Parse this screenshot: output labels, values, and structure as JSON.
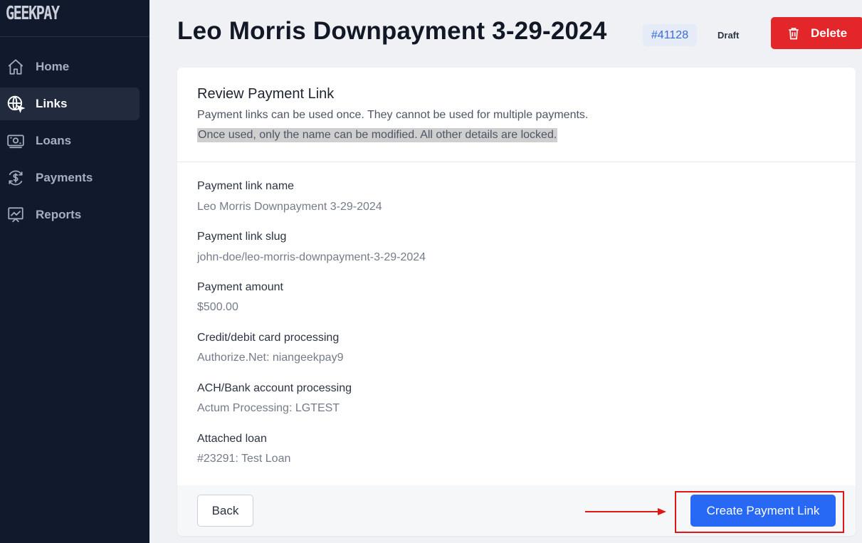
{
  "app": {
    "logo": "GEEKPAY"
  },
  "sidebar": {
    "items": [
      {
        "label": "Home",
        "icon": "home-icon",
        "active": false
      },
      {
        "label": "Links",
        "icon": "globe-link-icon",
        "active": true
      },
      {
        "label": "Loans",
        "icon": "money-icon",
        "active": false
      },
      {
        "label": "Payments",
        "icon": "dollar-cycle-icon",
        "active": false
      },
      {
        "label": "Reports",
        "icon": "chart-board-icon",
        "active": false
      }
    ]
  },
  "header": {
    "title": "Leo Morris Downpayment 3-29-2024",
    "id_badge": "#41128",
    "status": "Draft",
    "delete_label": "Delete"
  },
  "card": {
    "title": "Review Payment Link",
    "description": "Payment links can be used once. They cannot be used for multiple payments.",
    "description_highlighted": "Once used, only the name can be modified. All other details are locked.",
    "fields": [
      {
        "label": "Payment link name",
        "value": "Leo Morris Downpayment 3-29-2024"
      },
      {
        "label": "Payment link slug",
        "value": "john-doe/leo-morris-downpayment-3-29-2024"
      },
      {
        "label": "Payment amount",
        "value": "$500.00"
      },
      {
        "label": "Credit/debit card processing",
        "value": "Authorize.Net: niangeekpay9"
      },
      {
        "label": "ACH/Bank account processing",
        "value": "Actum Processing: LGTEST"
      },
      {
        "label": "Attached loan",
        "value": "#23291: Test Loan"
      }
    ]
  },
  "footer": {
    "back_label": "Back",
    "create_label": "Create Payment Link"
  },
  "colors": {
    "sidebar_bg": "#111a2c",
    "primary": "#2768f4",
    "danger": "#e3262a",
    "annotation": "#e01717"
  }
}
